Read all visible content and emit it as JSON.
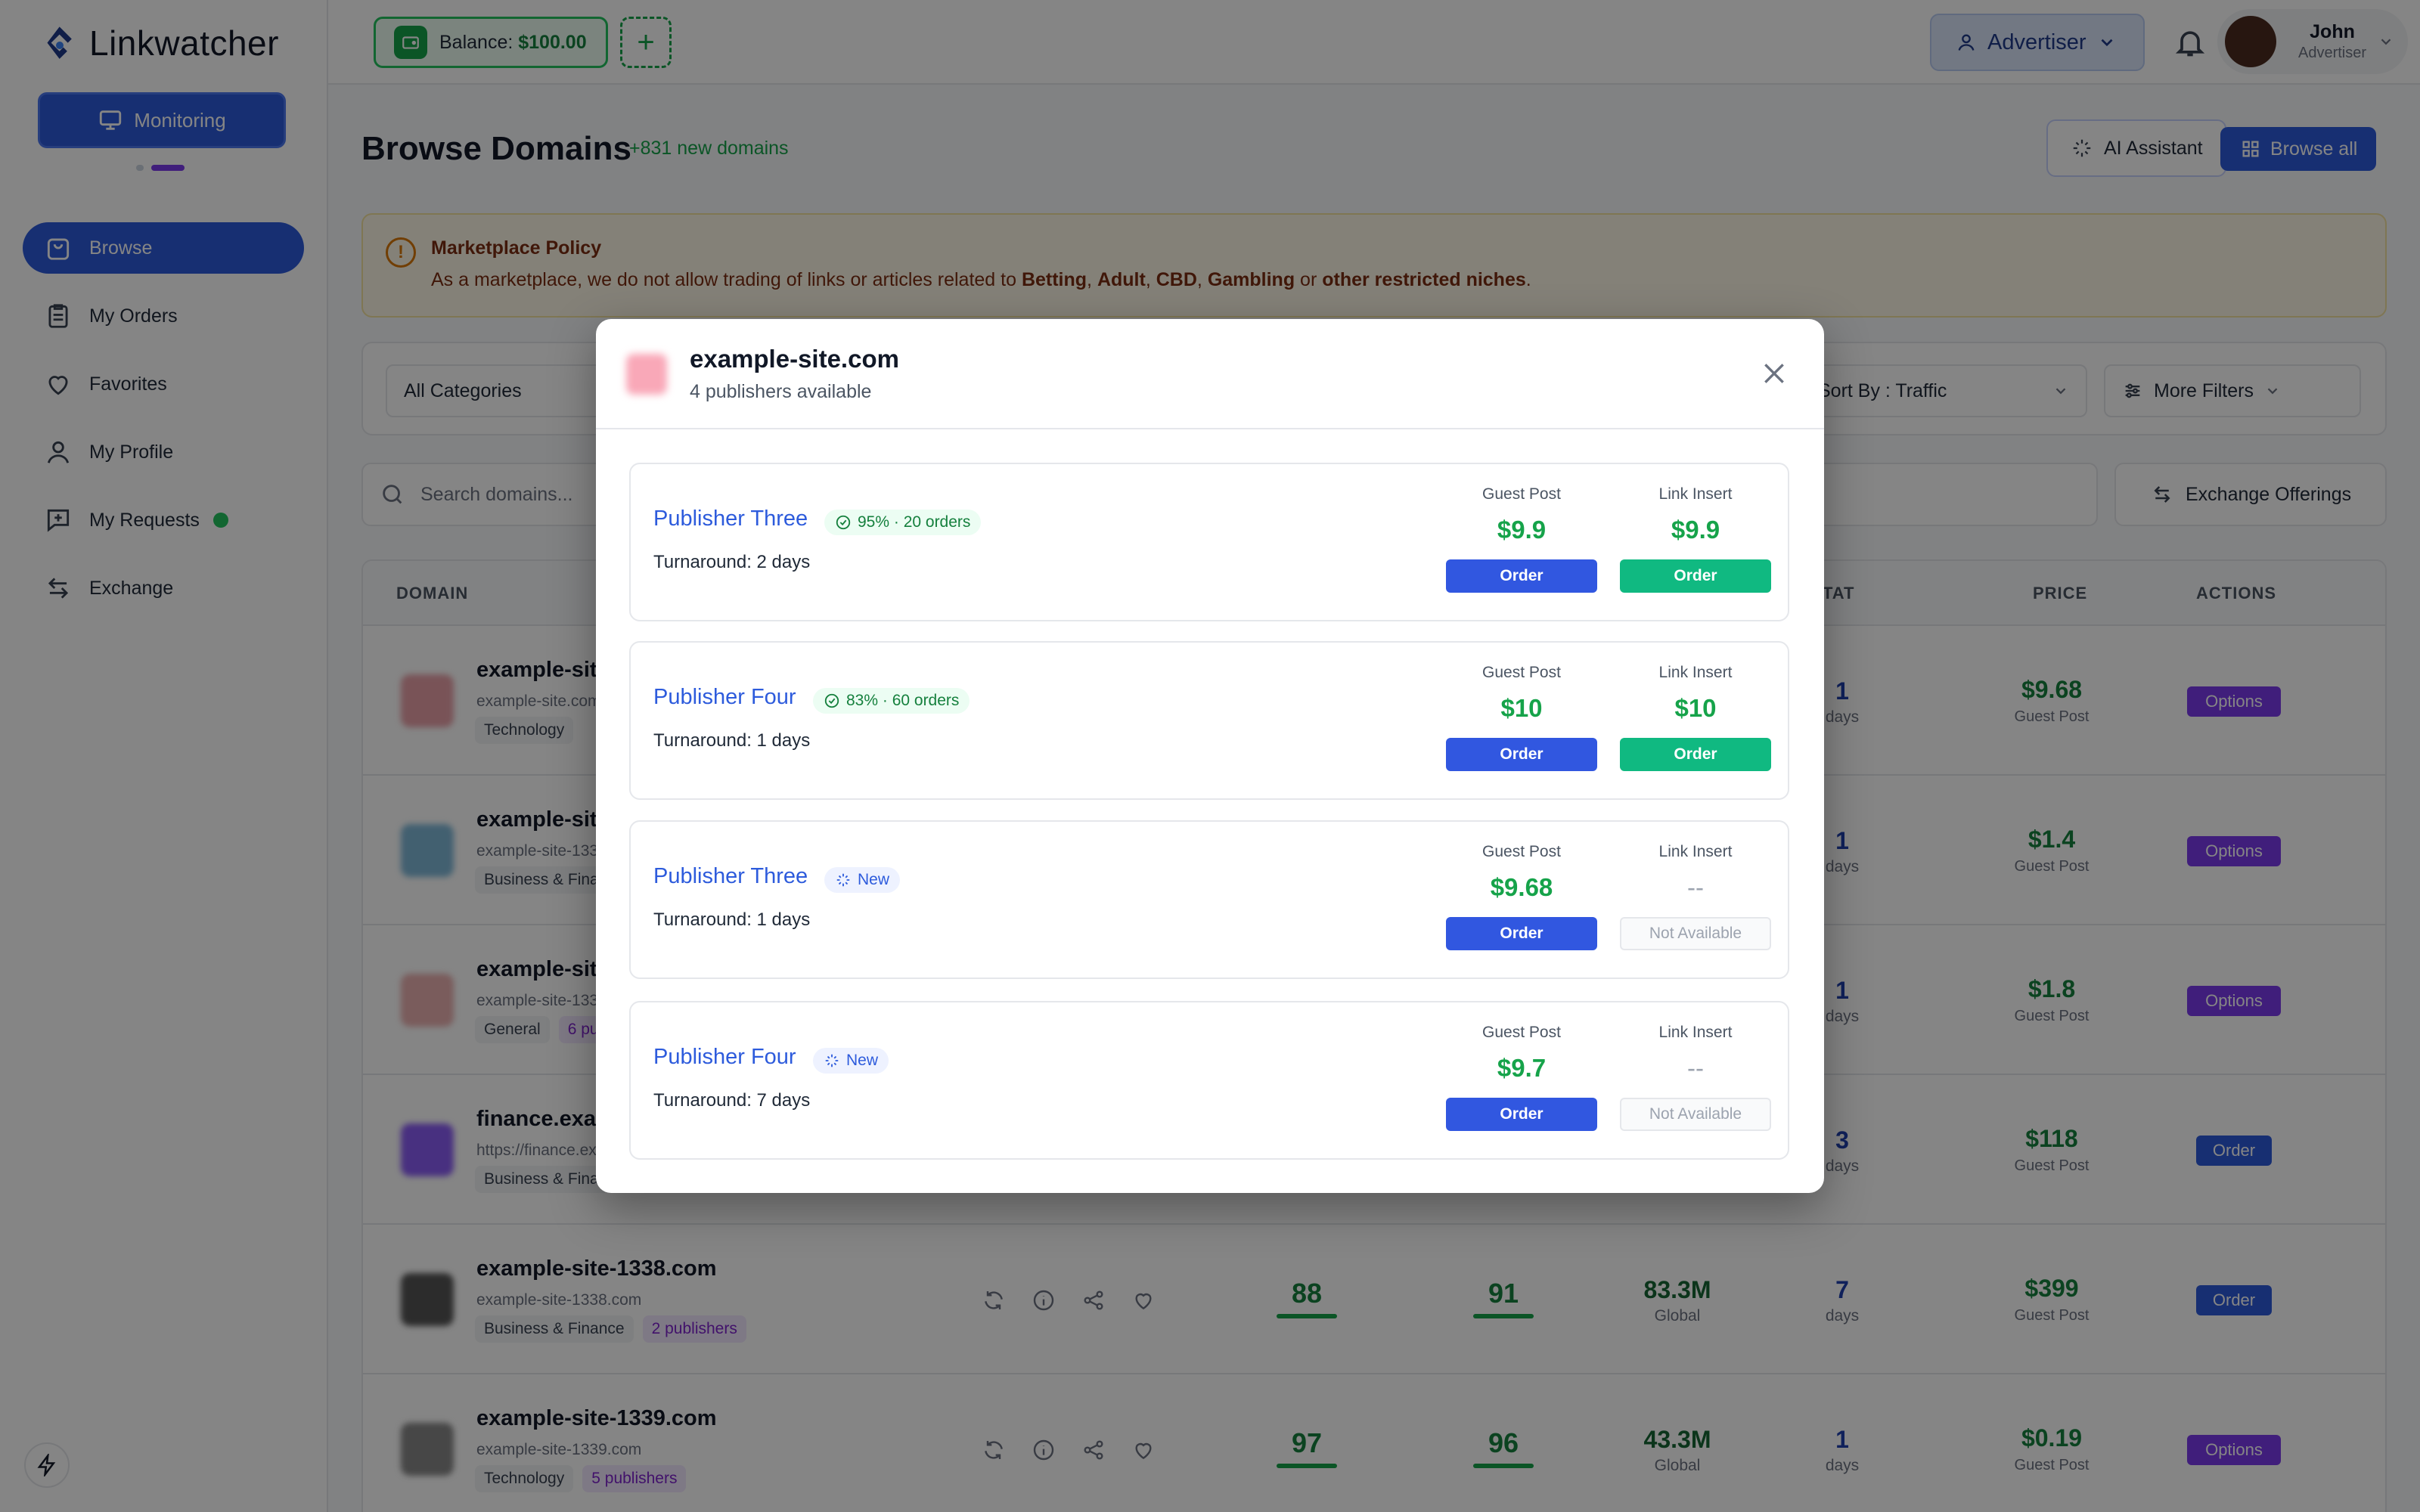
{
  "app": {
    "name": "Linkwatcher",
    "monitor_label": "Monitoring"
  },
  "sidebar": {
    "items": [
      {
        "label": "Browse",
        "icon": "bag-icon",
        "active": true
      },
      {
        "label": "My Orders",
        "icon": "clipboard-icon"
      },
      {
        "label": "Favorites",
        "icon": "heart-icon"
      },
      {
        "label": "My Profile",
        "icon": "user-icon"
      },
      {
        "label": "My Requests",
        "icon": "message-plus-icon",
        "status_dot": true
      },
      {
        "label": "Exchange",
        "icon": "arrows-icon"
      }
    ]
  },
  "topbar": {
    "balance_label": "Balance: ",
    "balance_value": "$100.00",
    "role": "Advertiser",
    "user_name": "John",
    "user_role": "Advertiser"
  },
  "main": {
    "title": "Browse Domains",
    "new_domains": "+831 new domains",
    "ai_assistant": "AI Assistant",
    "browse_all": "Browse all",
    "policy_title": "Marketplace Policy",
    "policy_text_1": "As a marketplace, we do not allow trading of links or articles related to ",
    "policy_b1": "Betting",
    "policy_sep1": ", ",
    "policy_b2": "Adult",
    "policy_sep2": ", ",
    "policy_b3": "CBD",
    "policy_sep3": ", ",
    "policy_b4": "Gambling",
    "policy_or": " or ",
    "policy_b5": "other restricted niches",
    "policy_end": ".",
    "category_select": "All Categories",
    "sort_select": "Sort By : Traffic",
    "more_filters": "More Filters",
    "search_placeholder": "Search domains...",
    "exchange_offerings": "Exchange Offerings"
  },
  "table": {
    "headers": {
      "domain": "DOMAIN",
      "tat": "TAT",
      "price": "PRICE",
      "actions": "ACTIONS"
    },
    "rows": [
      {
        "name": "example-site-1333.com",
        "url": "example-site.com",
        "tags": [
          "Technology"
        ],
        "publishers": "",
        "m1": "",
        "m2": "",
        "traffic": "",
        "traffic_sub": "",
        "tat": "1",
        "tat_sub": "days",
        "price": "$9.68",
        "price_sub": "Guest Post",
        "action": "Options",
        "fav": "#e8a0a8"
      },
      {
        "name": "example-site-1336.com",
        "url": "example-site-1336.com",
        "tags": [
          "Business & Finance"
        ],
        "publishers": "",
        "m1": "",
        "m2": "",
        "traffic": "",
        "traffic_sub": "",
        "tat": "1",
        "tat_sub": "days",
        "price": "$1.4",
        "price_sub": "Guest Post",
        "action": "Options",
        "fav": "#7fb8d8"
      },
      {
        "name": "example-site-1337.com",
        "url": "example-site-1337.com",
        "tags": [
          "General"
        ],
        "publishers": "6 publishers",
        "m1": "",
        "m2": "",
        "traffic": "",
        "traffic_sub": "",
        "tat": "1",
        "tat_sub": "days",
        "price": "$1.8",
        "price_sub": "Guest Post",
        "action": "Options",
        "fav": "#eab0b0"
      },
      {
        "name": "finance.example.com",
        "url": "https://finance.example.com",
        "tags": [
          "Business & Finance"
        ],
        "publishers": "",
        "m1": "",
        "m2": "",
        "traffic": "",
        "traffic_sub": "",
        "tat": "3",
        "tat_sub": "days",
        "price": "$118",
        "price_sub": "Guest Post",
        "action": "Order",
        "fav": "#8b5cf6"
      },
      {
        "name": "example-site-1338.com",
        "url": "example-site-1338.com",
        "tags": [
          "Business & Finance"
        ],
        "publishers": "2 publishers",
        "m1": "88",
        "m2": "91",
        "traffic": "83.3M",
        "traffic_sub": "Global",
        "tat": "7",
        "tat_sub": "days",
        "price": "$399",
        "price_sub": "Guest Post",
        "action": "Order",
        "fav": "#555555"
      },
      {
        "name": "example-site-1339.com",
        "url": "example-site-1339.com",
        "tags": [
          "Technology"
        ],
        "publishers": "5 publishers",
        "m1": "97",
        "m2": "96",
        "traffic": "43.3M",
        "traffic_sub": "Global",
        "tat": "1",
        "tat_sub": "days",
        "price": "$0.19",
        "price_sub": "Guest Post",
        "action": "Options",
        "fav": "#888888"
      }
    ]
  },
  "modal": {
    "domain": "example-site.com",
    "subtitle": "4 publishers available",
    "guest_post_label": "Guest Post",
    "link_insert_label": "Link Insert",
    "order_label": "Order",
    "not_available_label": "Not Available",
    "publishers": [
      {
        "name": "Publisher Three",
        "badge": "95% · 20 orders",
        "badge_type": "verified",
        "turnaround": "Turnaround: 2 days",
        "gp_price": "$9.9",
        "li_price": "$9.9",
        "li_available": true
      },
      {
        "name": "Publisher Four",
        "badge": "83% · 60 orders",
        "badge_type": "verified",
        "turnaround": "Turnaround: 1 days",
        "gp_price": "$10",
        "li_price": "$10",
        "li_available": true
      },
      {
        "name": "Publisher Three",
        "badge": "New",
        "badge_type": "new",
        "turnaround": "Turnaround: 1 days",
        "gp_price": "$9.68",
        "li_price": "--",
        "li_available": false
      },
      {
        "name": "Publisher Four",
        "badge": "New",
        "badge_type": "new",
        "turnaround": "Turnaround: 7 days",
        "gp_price": "$9.7",
        "li_price": "--",
        "li_available": false
      }
    ]
  },
  "colors": {
    "primary": "#2d5bdc",
    "success": "#16a34a",
    "options": "#7c3aed",
    "link_insert": "#10b981"
  }
}
